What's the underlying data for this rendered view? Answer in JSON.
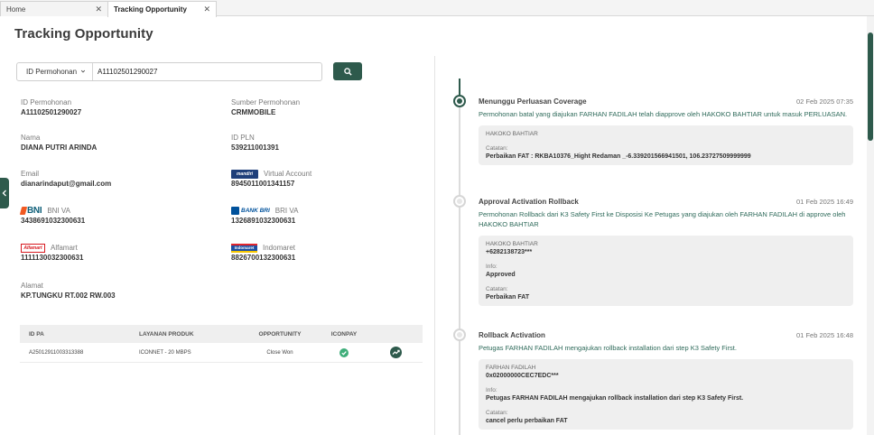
{
  "tabs": [
    {
      "label": "Home"
    },
    {
      "label": "Tracking Opportunity"
    }
  ],
  "page_title": "Tracking Opportunity",
  "search": {
    "select_value": "ID Permohonan",
    "input_value": "A11102501290027"
  },
  "fields": {
    "id_permohonan": {
      "label": "ID Permohonan",
      "value": "A11102501290027"
    },
    "sumber": {
      "label": "Sumber Permohonan",
      "value": "CRMMOBILE"
    },
    "nama": {
      "label": "Nama",
      "value": "DIANA PUTRI ARINDA"
    },
    "id_pln": {
      "label": "ID PLN",
      "value": "539211001391"
    },
    "email": {
      "label": "Email",
      "value": "dianarindaput@gmail.com"
    },
    "mandiri": {
      "logo": "mandiri",
      "label": "Virtual Account",
      "value": "8945011001341157"
    },
    "bni": {
      "logo": "BNI",
      "label": "BNI VA",
      "value": "3438691032300631"
    },
    "bri": {
      "logo": "BANK BRI",
      "label": "BRI VA",
      "value": "1326891032300631"
    },
    "alfamart": {
      "logo": "Alfamart",
      "label": "Alfamart",
      "value": "1111130032300631"
    },
    "indomaret": {
      "logo": "Indomaret",
      "label": "Indomaret",
      "value": "8826700132300631"
    },
    "alamat": {
      "label": "Alamat",
      "value": "KP.TUNGKU RT.002 RW.003"
    }
  },
  "table": {
    "headers": [
      "ID PA",
      "LAYANAN PRODUK",
      "OPPORTUNITY",
      "ICONPAY"
    ],
    "rows": [
      {
        "id_pa": "A25012911003313388",
        "layanan": "ICONNET - 20 MBPS",
        "opportunity": "Close Won",
        "iconpay": "check-icon",
        "action": "trend-icon"
      }
    ]
  },
  "timeline": [
    {
      "title": "Menunggu Perluasan Coverage",
      "date": "02 Feb 2025 07:35",
      "desc": "Permohonan batal yang diajukan FARHAN FADILAH telah diapprove oleh HAKOKO BAHTIAR untuk masuk PERLUASAN.",
      "note": {
        "who": "HAKOKO BAHTIAR",
        "catatan_label": "Catatan:",
        "catatan": "Perbaikan FAT :  RKBA10376_Hight Redaman _-6.339201566941501, 106.23727509999999"
      }
    },
    {
      "title": "Approval Activation Rollback",
      "date": "01 Feb 2025 16:49",
      "desc": "Permohonan Rollback dari K3 Safety First ke Disposisi Ke Petugas yang diajukan oleh FARHAN FADILAH di approve oleh HAKOKO BAHTIAR",
      "note": {
        "who": "HAKOKO BAHTIAR",
        "who_value": "+6282138723***",
        "info_label": "Info:",
        "info": "Approved",
        "catatan_label": "Catatan:",
        "catatan": "Perbaikan FAT"
      }
    },
    {
      "title": "Rollback Activation",
      "date": "01 Feb 2025 16:48",
      "desc": "Petugas FARHAN FADILAH mengajukan rollback installation dari step K3 Safety First.",
      "note": {
        "who": "FARHAN FADILAH",
        "who_value": "0x02000000CEC7EDC***",
        "info_label": "Info:",
        "info": "Petugas FARHAN FADILAH mengajukan rollback installation dari step K3 Safety First.",
        "catatan_label": "Catatan:",
        "catatan": "cancel perlu perbaikan FAT"
      }
    }
  ],
  "colors": {
    "primary": "#2e5a4c",
    "link_text": "#2e6a5a",
    "bni": "#f15a22",
    "bri": "#00529c",
    "alfamart_red": "#d71920"
  }
}
